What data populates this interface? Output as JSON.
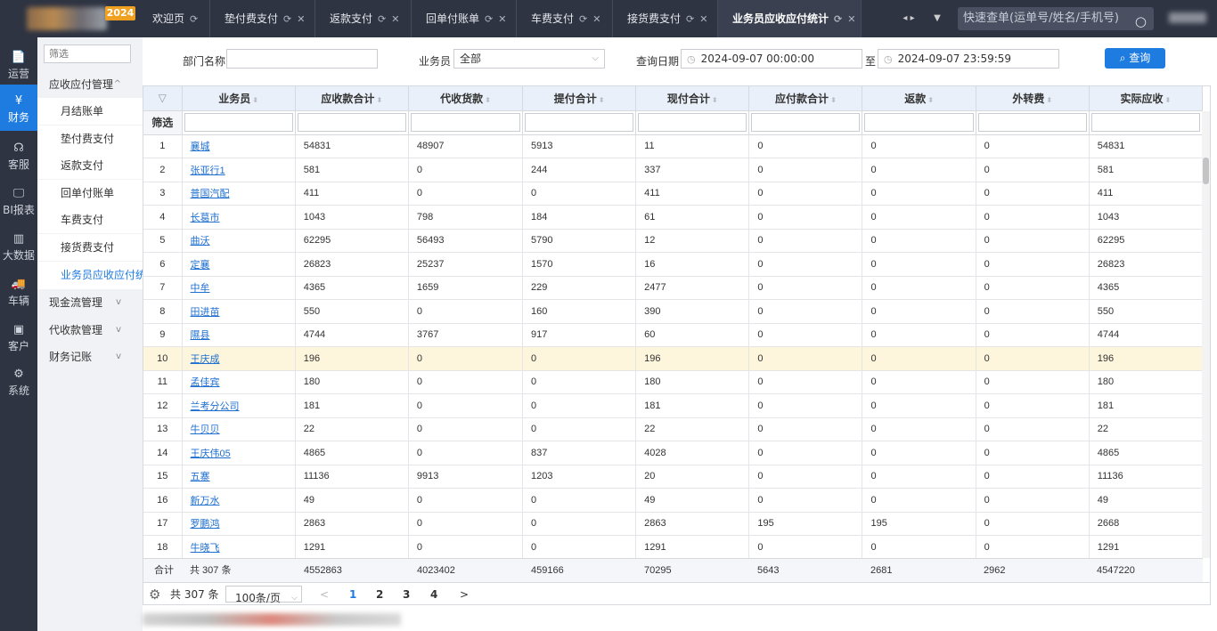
{
  "logo": {
    "year": "2024"
  },
  "leftnav": [
    {
      "icon": "📄",
      "label": "运营"
    },
    {
      "icon": "¥",
      "label": "财务"
    },
    {
      "icon": "☊",
      "label": "客服"
    },
    {
      "icon": "🖵",
      "label": "BI报表"
    },
    {
      "icon": "▥",
      "label": "大数据"
    },
    {
      "icon": "🚚",
      "label": "车辆"
    },
    {
      "icon": "▣",
      "label": "客户"
    },
    {
      "icon": "⚙",
      "label": "系统"
    }
  ],
  "subnav": {
    "filter_placeholder": "筛选",
    "groups": [
      {
        "label": "应收应付管理",
        "chev": "^"
      },
      {
        "label": "现金流管理",
        "chev": "v"
      },
      {
        "label": "代收款管理",
        "chev": "v"
      },
      {
        "label": "财务记账",
        "chev": "v"
      }
    ],
    "children": [
      "月结账单",
      "垫付费支付",
      "返款支付",
      "回单付账单",
      "车费支付",
      "接货费支付",
      "业务员应收应付统计"
    ]
  },
  "tabs": [
    {
      "label": "欢迎页"
    },
    {
      "label": "垫付费支付"
    },
    {
      "label": "返款支付"
    },
    {
      "label": "回单付账单"
    },
    {
      "label": "车费支付"
    },
    {
      "label": "接货费支付"
    },
    {
      "label": "业务员应收应付统计"
    }
  ],
  "search": {
    "placeholder": "快速查单(运单号/姓名/手机号)"
  },
  "filters": {
    "dept_label": "部门名称",
    "dept_value": "",
    "staff_label": "业务员",
    "staff_value": "全部",
    "date_label": "查询日期",
    "date_from": "2024-09-07 00:00:00",
    "date_sep": "至",
    "date_to": "2024-09-07 23:59:59",
    "query_button": "查询"
  },
  "table": {
    "filter_label": "筛选",
    "columns": [
      "业务员",
      "应收款合计",
      "代收货款",
      "提付合计",
      "现付合计",
      "应付款合计",
      "返款",
      "外转费",
      "实际应收"
    ],
    "rows": [
      [
        "1",
        "襄城",
        "54831",
        "48907",
        "5913",
        "11",
        "0",
        "0",
        "0",
        "54831"
      ],
      [
        "2",
        "张亚行1",
        "581",
        "0",
        "244",
        "337",
        "0",
        "0",
        "0",
        "581"
      ],
      [
        "3",
        "普国汽配",
        "411",
        "0",
        "0",
        "411",
        "0",
        "0",
        "0",
        "411"
      ],
      [
        "4",
        "长葛市",
        "1043",
        "798",
        "184",
        "61",
        "0",
        "0",
        "0",
        "1043"
      ],
      [
        "5",
        "曲沃",
        "62295",
        "56493",
        "5790",
        "12",
        "0",
        "0",
        "0",
        "62295"
      ],
      [
        "6",
        "定襄",
        "26823",
        "25237",
        "1570",
        "16",
        "0",
        "0",
        "0",
        "26823"
      ],
      [
        "7",
        "中牟",
        "4365",
        "1659",
        "229",
        "2477",
        "0",
        "0",
        "0",
        "4365"
      ],
      [
        "8",
        "田进苗",
        "550",
        "0",
        "160",
        "390",
        "0",
        "0",
        "0",
        "550"
      ],
      [
        "9",
        "隰县",
        "4744",
        "3767",
        "917",
        "60",
        "0",
        "0",
        "0",
        "4744"
      ],
      [
        "10",
        "王庆成",
        "196",
        "0",
        "0",
        "196",
        "0",
        "0",
        "0",
        "196"
      ],
      [
        "11",
        "孟佳宾",
        "180",
        "0",
        "0",
        "180",
        "0",
        "0",
        "0",
        "180"
      ],
      [
        "12",
        "兰考分公司",
        "181",
        "0",
        "0",
        "181",
        "0",
        "0",
        "0",
        "181"
      ],
      [
        "13",
        "牛贝贝",
        "22",
        "0",
        "0",
        "22",
        "0",
        "0",
        "0",
        "22"
      ],
      [
        "14",
        "王庆伟05",
        "4865",
        "0",
        "837",
        "4028",
        "0",
        "0",
        "0",
        "4865"
      ],
      [
        "15",
        "五寨",
        "11136",
        "9913",
        "1203",
        "20",
        "0",
        "0",
        "0",
        "11136"
      ],
      [
        "16",
        "新万水",
        "49",
        "0",
        "0",
        "49",
        "0",
        "0",
        "0",
        "49"
      ],
      [
        "17",
        "罗鹏鸿",
        "2863",
        "0",
        "0",
        "2863",
        "195",
        "195",
        "0",
        "2668"
      ],
      [
        "18",
        "牛晓飞",
        "1291",
        "0",
        "0",
        "1291",
        "0",
        "0",
        "0",
        "1291"
      ]
    ],
    "highlighted_row": 10,
    "summary": {
      "label": "合计",
      "count": "共 307 条",
      "values": [
        "4552863",
        "4023402",
        "459166",
        "70295",
        "5643",
        "2681",
        "2962",
        "4547220"
      ]
    }
  },
  "pager": {
    "total": "共 307 条",
    "page_size": "100条/页",
    "prev": "<",
    "pages": [
      "1",
      "2",
      "3",
      "4"
    ],
    "current": "1",
    "next": ">"
  }
}
